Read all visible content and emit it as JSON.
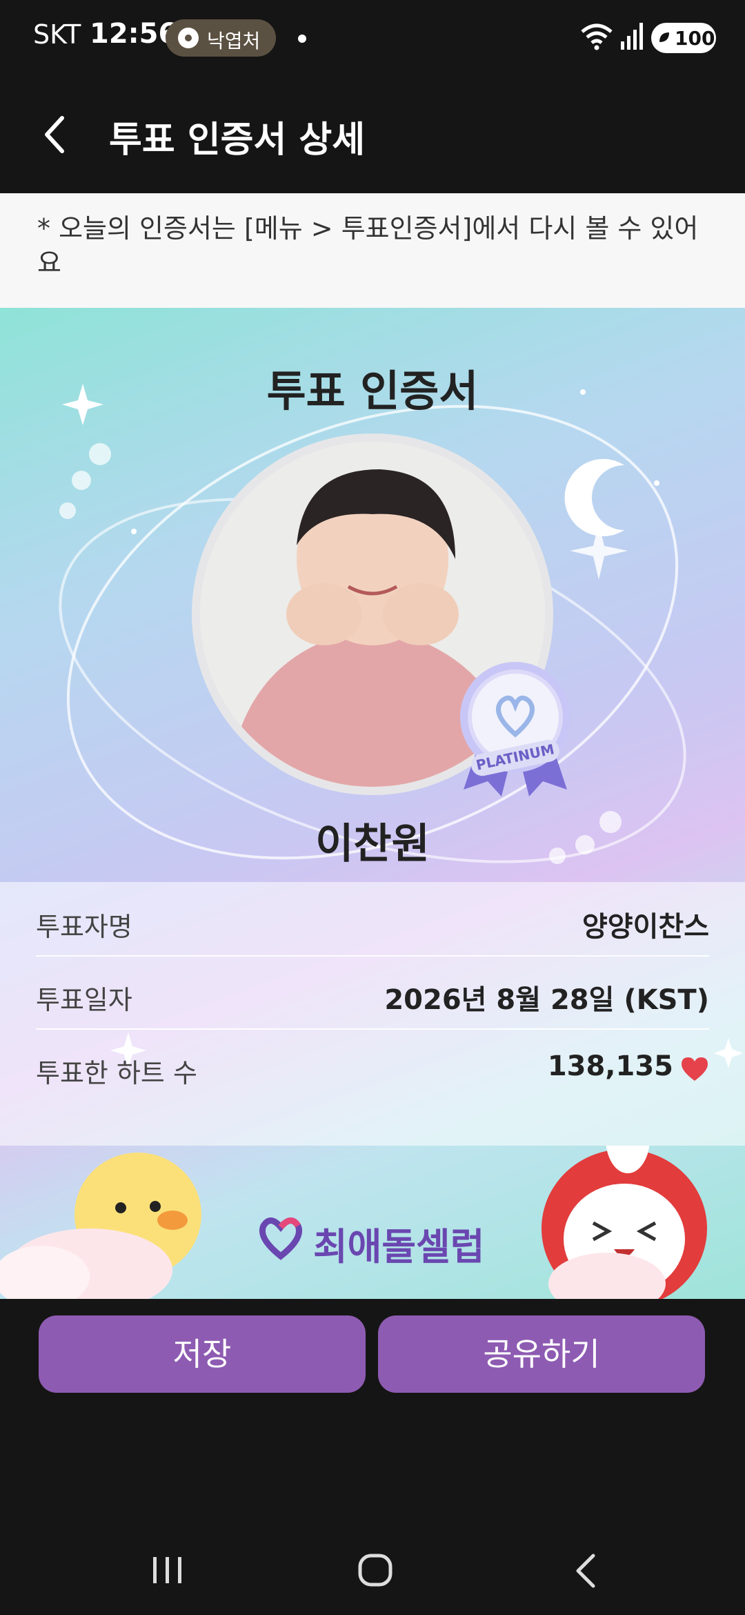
{
  "status_bar": {
    "carrier": "SKT",
    "time": "12:56",
    "pill_text": "낙엽처",
    "battery": "100"
  },
  "app_bar": {
    "title": "투표 인증서 상세"
  },
  "notice": {
    "text": "* 오늘의 인증서는 [메뉴 > 투표인증서]에서 다시 볼 수 있어요"
  },
  "certificate": {
    "title": "투표 인증서",
    "badge_label": "PLATINUM",
    "idol_name": "이찬원",
    "rows": [
      {
        "label": "투표자명",
        "value": "양양이찬스"
      },
      {
        "label": "투표일자",
        "value": "2026년 8월 28일 (KST)"
      },
      {
        "label": "투표한 하트 수",
        "value": "138,135"
      }
    ],
    "brand": "최애돌셀럽"
  },
  "actions": {
    "save": "저장",
    "share": "공유하기"
  },
  "colors": {
    "accent_button": "#8e5bb2",
    "heart": "#e5424b",
    "brand": "#6a47b0"
  }
}
